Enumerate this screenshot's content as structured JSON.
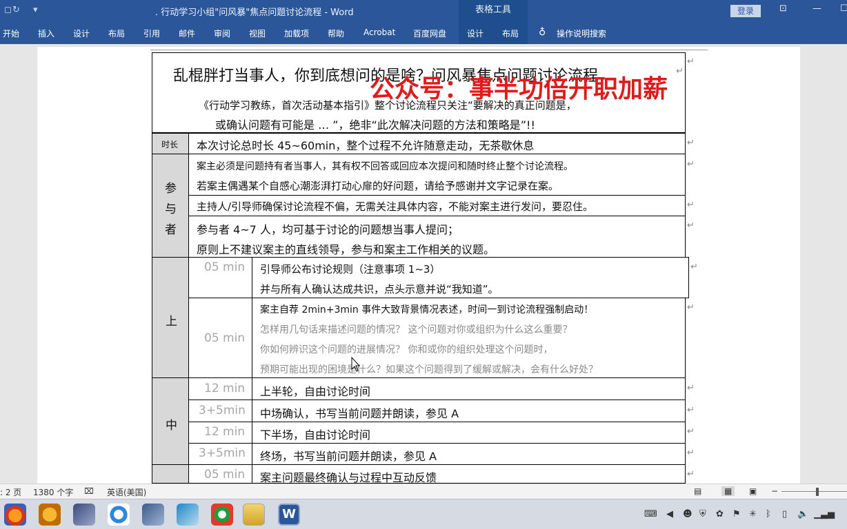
{
  "window": {
    "title": ". 行动学习小组\"问风暴\"焦点问题讨论流程  -  Word",
    "context_tools": "表格工具",
    "login": "登录"
  },
  "ribbon": {
    "tabs": [
      "开始",
      "插入",
      "设计",
      "布局",
      "引用",
      "邮件",
      "审阅",
      "视图",
      "加载项",
      "帮助",
      "Acrobat",
      "百度网盘",
      "设计",
      "布局"
    ],
    "search": "操作说明搜索"
  },
  "document": {
    "title": "乱棍胖打当事人，你到底想问的是啥？问风暴焦点问题讨论流程",
    "watermark": "公众号：事半功倍开职加薪",
    "subtitle_1": "《行动学习教练，首次活动基本指引》整个讨论流程只关注“要解决的真正问题是，",
    "subtitle_2": "或确认问题有可能是 … ”，绝非“此次解决问题的方法和策略是”!!",
    "rows": {
      "duration_label": "时长",
      "duration_text": "本次讨论总时长 45~60min，整个过程不允许随意走动，无茶歇休息",
      "participants_label": [
        "参",
        "与",
        "者"
      ],
      "p_owner_1": "案主必须是问题持有者当事人，其有权不回答或回应本次提问和随时终止整个讨论流程。",
      "p_owner_2": "若案主偶遇某个自感心潮澎湃打动心扉的好问题，请给予感谢并文字记录在案。",
      "p_host": "主持人/引导师确保讨论流程不偏，无需关注具体内容，不能对案主进行发问，要忍住。",
      "p_members_1": "参与者  4~7 人，均可基于讨论的问题想当事人提问；",
      "p_members_2": "原则上不建议案主的直线领导，参与和案主工作相关的议题。",
      "upper_label": "上",
      "u1_time": "05 min",
      "u1_text_1": "引导师公布讨论规则（注意事项  1~3）",
      "u1_text_2": "并与所有人确认达成共识，点头示意并说“我知道”。",
      "u2_time": "05 min",
      "u2_text_1": "案主自荐 2min+3min 事件大致背景情况表述，时间一到讨论流程强制启动！",
      "u2_text_2": "怎样用几句话来描述问题的情况？   这个问题对你或组织为什么这么重要？",
      "u2_text_3": "你如何辨识这个问题的进展情况？   你和或你的组织处理这个问题时，",
      "u2_text_4": "预期可能出现的困境是什么？如果这个问题得到了缓解或解决，会有什么好处？",
      "middle_label": "中",
      "m1_time": "12 min",
      "m1_text": "上半轮，自由讨论时间",
      "m2_time": "3+5min",
      "m2_text": "中场确认，书写当前问题并朗读，参见  A",
      "m3_time": "12 min",
      "m3_text": "下半场，自由讨论时间",
      "m4_time": "3+5min",
      "m4_text": "终场，书写当前问题并朗读，参见  A",
      "l1_time": "05 min",
      "l1_text": "案主问题最终确认与过程中互动反馈"
    }
  },
  "statusbar": {
    "page": ": 2 页",
    "words": "1380 个字",
    "language": "英语(美国)"
  },
  "colors": {
    "word_blue": "#2b579a",
    "context_blue": "#1f4e8e",
    "watermark_red": "#e11a1a",
    "label_gray": "#d8d8d8"
  }
}
